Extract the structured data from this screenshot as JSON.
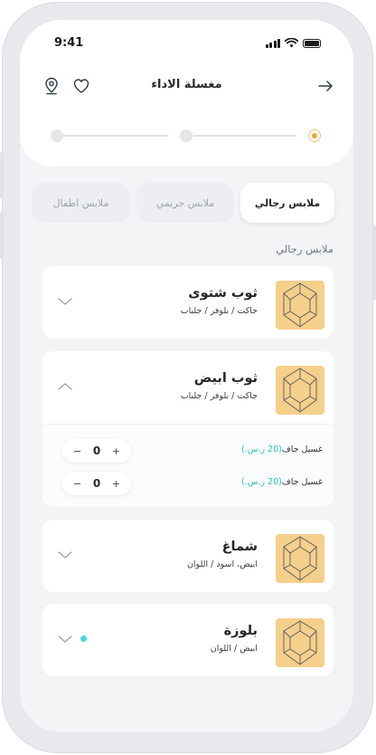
{
  "status": {
    "time": "9:41"
  },
  "nav": {
    "title": "مغسلة الاداء"
  },
  "tabs": [
    {
      "label": "ملابس رجالي",
      "active": true
    },
    {
      "label": "ملابس حريمي",
      "active": false
    },
    {
      "label": "ملابس اطفال",
      "active": false
    }
  ],
  "section_title": "ملابس رجالي",
  "items": [
    {
      "title": "ثوب شتوى",
      "subtitle": "جاكت / بلوفر / جلباب",
      "expanded": false
    },
    {
      "title": "ثوب ابيض",
      "subtitle": "جاكت / بلوفر / جلباب",
      "expanded": true,
      "services": [
        {
          "label": "غسيل جاف",
          "price": "(20 ر.س.)",
          "qty": "0",
          "plus": "+",
          "minus": "−"
        },
        {
          "label": "غسيل جاف",
          "price": "(20 ر.س.)",
          "qty": "0",
          "plus": "+",
          "minus": "−"
        }
      ]
    },
    {
      "title": "شماغ",
      "subtitle": "ابيض، اسود / اللوان",
      "expanded": false
    },
    {
      "title": "بلوزة",
      "subtitle": "ابيض / اللوان",
      "expanded": false,
      "has_dot": true
    }
  ],
  "colors": {
    "accent": "#2fbfc6",
    "progress_active": "#e5a93a",
    "thumb_bg": "#f5cf8c"
  },
  "progress": {
    "steps": 3,
    "current": 1
  }
}
